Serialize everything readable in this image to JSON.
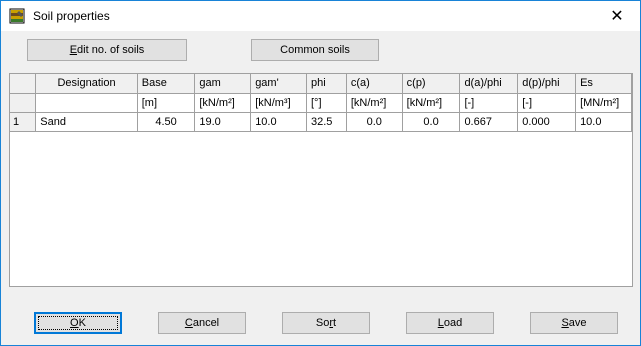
{
  "window": {
    "title": "Soil properties",
    "close_glyph": "✕"
  },
  "toolbar": {
    "edit_soils_prefix": "",
    "edit_soils_mnemonic": "E",
    "edit_soils_rest": "dit no. of soils",
    "common_soils_label": "Common soils"
  },
  "grid": {
    "headers": [
      "Designation",
      "Base",
      "gam",
      "gam'",
      "phi",
      "c(a)",
      "c(p)",
      "d(a)/phi",
      "d(p)/phi",
      "Es"
    ],
    "units": [
      "",
      "[m]",
      "[kN/m²]",
      "[kN/m³]",
      "[°]",
      "[kN/m²]",
      "[kN/m²]",
      "[-]",
      "[-]",
      "[MN/m²]"
    ],
    "rows": [
      {
        "index": "1",
        "cells": [
          "Sand",
          "4.50",
          "19.0",
          "10.0",
          "32.5",
          "0.0",
          "0.0",
          "0.667",
          "0.000",
          "10.0"
        ]
      }
    ]
  },
  "buttons": {
    "ok_mnemonic": "O",
    "ok_rest": "K",
    "cancel_mnemonic": "C",
    "cancel_rest": "ancel",
    "sort_prefix": "So",
    "sort_mnemonic": "r",
    "sort_rest": "t",
    "load_mnemonic": "L",
    "load_rest": "oad",
    "save_mnemonic": "S",
    "save_rest": "ave"
  },
  "colors": {
    "window_border": "#1883d7",
    "focus_border": "#0078d7",
    "button_face": "#e1e1e1",
    "dialog_bg": "#f0f0f0"
  },
  "icons": {
    "app": "soil-layers-icon",
    "close": "close-icon"
  }
}
